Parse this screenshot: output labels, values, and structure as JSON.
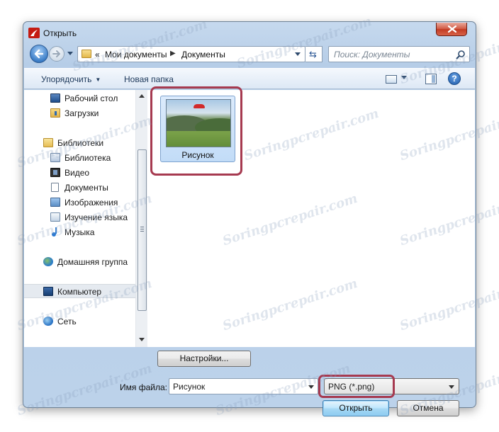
{
  "window": {
    "title": "Открыть"
  },
  "navigation": {
    "breadcrumb_prefix": "«",
    "breadcrumbs": [
      "Мои документы",
      "Документы"
    ],
    "search_placeholder": "Поиск: Документы"
  },
  "toolbar": {
    "organize_label": "Упорядочить",
    "new_folder_label": "Новая папка"
  },
  "sidebar": {
    "items": [
      {
        "label": "Рабочий стол",
        "icon": "desktop-icon"
      },
      {
        "label": "Загрузки",
        "icon": "downloads-folder-icon"
      },
      {
        "label": "Библиотеки",
        "icon": "libraries-icon"
      },
      {
        "label": "Библиотека",
        "icon": "library-icon"
      },
      {
        "label": "Видео",
        "icon": "video-library-icon"
      },
      {
        "label": "Документы",
        "icon": "documents-library-icon"
      },
      {
        "label": "Изображения",
        "icon": "images-library-icon"
      },
      {
        "label": "Изучение языка",
        "icon": "library-icon"
      },
      {
        "label": "Музыка",
        "icon": "music-library-icon"
      },
      {
        "label": "Домашняя группа",
        "icon": "homegroup-icon"
      },
      {
        "label": "Компьютер",
        "icon": "computer-icon",
        "selected": true
      },
      {
        "label": "Сеть",
        "icon": "network-icon"
      }
    ]
  },
  "files": [
    {
      "name": "Рисунок",
      "type": "image-thumbnail",
      "selected": true
    }
  ],
  "bottom": {
    "settings_button": "Настройки...",
    "filename_label": "Имя файла:",
    "filename_value": "Рисунок",
    "filetype_value": "PNG (*.png)",
    "open_button": "Открыть",
    "cancel_button": "Отмена"
  },
  "watermark": "Soringpcrepair.com",
  "colors": {
    "highlight_border": "#a63a50",
    "selection_fill": "#c2dcf7",
    "window_frame": "#b6cde7"
  }
}
